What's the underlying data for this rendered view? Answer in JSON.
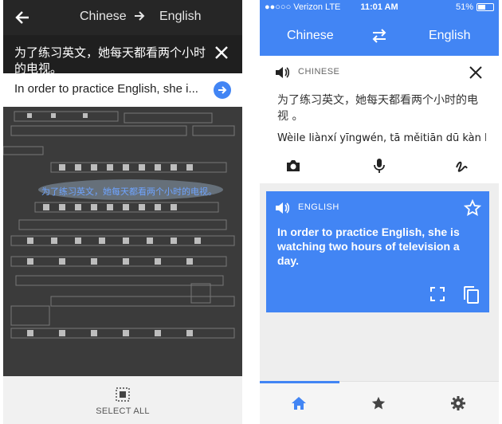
{
  "camera": {
    "header": {
      "source_lang": "Chinese",
      "target_lang": "English"
    },
    "detected_text": "为了练习英文，她每天都看两个小时的电视。",
    "translation_preview": "In order to practice English, she i...",
    "highlight_text": "为了练习英文，她每天都看两个小时的电视。",
    "footer": {
      "select_all_label": "SELECT ALL"
    }
  },
  "translate_app": {
    "status": {
      "carrier": "●●○○○ Verizon  LTE",
      "time": "11:01 AM",
      "battery": "51%"
    },
    "app_bar": {
      "source_lang": "Chinese",
      "target_lang": "English"
    },
    "source": {
      "lang_label": "CHINESE",
      "text": "为了练习英文，她每天都看两个小时的电视 。",
      "transliteration": "Wèile liànxí yīngwén, tā měitiān dū kàn l..."
    },
    "result": {
      "lang_label": "ENGLISH",
      "text": "In order to practice English, she is watching two hours of television a day."
    }
  },
  "colors": {
    "accent": "#4285f4",
    "camera_bg": "#2a2a2a"
  }
}
